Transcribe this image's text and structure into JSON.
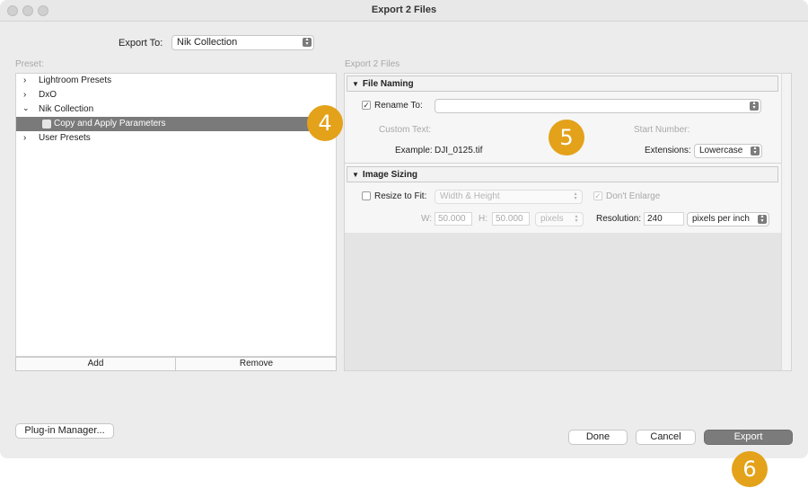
{
  "window": {
    "title": "Export 2 Files"
  },
  "export_to": {
    "label": "Export To:",
    "value": "Nik Collection"
  },
  "preset": {
    "label": "Preset:",
    "items": [
      {
        "label": "Lightroom Presets",
        "chevron": "chevron-right-icon"
      },
      {
        "label": "DxO",
        "chevron": "chevron-right-icon"
      },
      {
        "label": "Nik Collection",
        "chevron": "chevron-down-icon"
      },
      {
        "label": "Copy and Apply Parameters",
        "selected": true
      },
      {
        "label": "User Presets",
        "chevron": "chevron-right-icon"
      }
    ],
    "add_label": "Add",
    "remove_label": "Remove"
  },
  "right_header": "Export 2 Files",
  "file_naming": {
    "title": "File Naming",
    "rename_to_label": "Rename To:",
    "rename_to_value": "",
    "rename_checked": true,
    "custom_text_label": "Custom Text:",
    "start_number_label": "Start Number:",
    "example_label": "Example:",
    "example_value": "DJI_0125.tif",
    "extensions_label": "Extensions:",
    "extensions_value": "Lowercase"
  },
  "image_sizing": {
    "title": "Image Sizing",
    "resize_label": "Resize to Fit:",
    "resize_value": "Width & Height",
    "dont_enlarge_label": "Don't Enlarge",
    "w_label": "W:",
    "w_value": "50.000",
    "h_label": "H:",
    "h_value": "50.000",
    "unit_value": "pixels",
    "resolution_label": "Resolution:",
    "resolution_value": "240",
    "resolution_unit": "pixels per inch"
  },
  "footer": {
    "plugin_manager_label": "Plug-in Manager...",
    "done_label": "Done",
    "cancel_label": "Cancel",
    "export_label": "Export"
  },
  "badges": [
    "4",
    "5",
    "6"
  ],
  "colors": {
    "badge": "#e3a21a",
    "selection": "#7a7a7a"
  }
}
